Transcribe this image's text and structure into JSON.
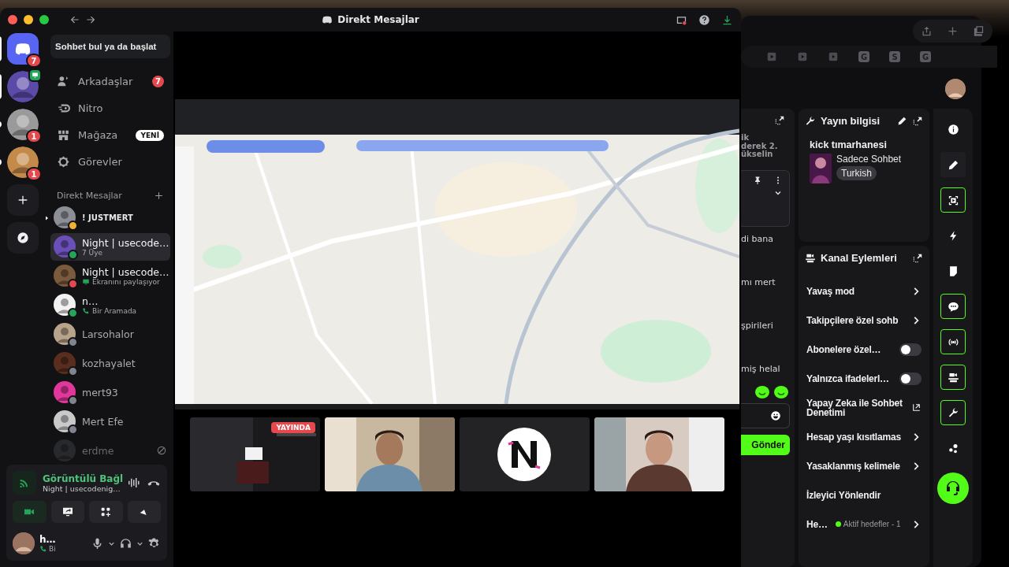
{
  "window": {
    "title": "Direkt Mesajlar"
  },
  "servers": [
    {
      "kind": "home",
      "selected": true,
      "unread": false,
      "badge": "7",
      "sharing": false
    },
    {
      "kind": "avatar",
      "selected": true,
      "unread": false,
      "sharing": true
    },
    {
      "kind": "avatar",
      "selected": false,
      "unread": true,
      "badge": "1",
      "sharing": false
    },
    {
      "kind": "avatar",
      "selected": false,
      "unread": true,
      "badge": "1",
      "sharing": false
    }
  ],
  "search": {
    "placeholder": "Sohbet bul ya da başlat"
  },
  "nav": [
    {
      "kind": "friends",
      "label": "Arkadaşlar",
      "badge": "7"
    },
    {
      "kind": "nitro",
      "label": "Nitro"
    },
    {
      "kind": "shop",
      "label": "Mağaza",
      "tag": "YENİ"
    },
    {
      "kind": "quests",
      "label": "Görevler"
    }
  ],
  "dm_header": {
    "title": "Direkt Mesajlar"
  },
  "dms": [
    {
      "kind": "plain",
      "name": "! JUSTMERT",
      "color": "#f0b232",
      "selected": false,
      "unread": true,
      "blocked": false
    },
    {
      "kind": "plain",
      "name": "Night | usecode…",
      "subtitle": "7 Üye",
      "color": "#23a55a",
      "selected": true,
      "unread": false,
      "blocked": false
    },
    {
      "kind": "screen",
      "name": "Night | usecode…",
      "subtitle": "Ekranını paylaşıyor",
      "color": "#e5484d",
      "selected": false,
      "unread": false,
      "blocked": false
    },
    {
      "kind": "call",
      "name": "n…",
      "subtitle": "Bir Aramada",
      "color": "#23a55a",
      "selected": false,
      "unread": false,
      "blocked": false
    },
    {
      "kind": "plain",
      "name": "Larsohalor",
      "color": "#80848e",
      "selected": false,
      "unread": false,
      "blocked": false
    },
    {
      "kind": "plain",
      "name": "kozhayalet",
      "color": "#80848e",
      "selected": false,
      "unread": false,
      "blocked": false
    },
    {
      "kind": "plain",
      "name": "mert93",
      "color": "#80848e",
      "selected": false,
      "unread": false,
      "blocked": false
    },
    {
      "kind": "plain",
      "name": "Mert Efe",
      "color": "#80848e",
      "selected": false,
      "unread": false,
      "blocked": false
    },
    {
      "kind": "plain",
      "name": "erdme",
      "selected": false,
      "unread": false,
      "blocked": true
    }
  ],
  "voice": {
    "status": "Görüntülü Bağl",
    "channel": "Night | usecodenig…",
    "camera_on": true
  },
  "user": {
    "name": "h…",
    "status": "Bi"
  },
  "stage": {
    "tiles": [
      {
        "kind": "screen",
        "live": "YAYINDA"
      },
      {
        "kind": "camera"
      },
      {
        "kind": "avatar"
      },
      {
        "kind": "camera"
      }
    ]
  },
  "browser_tabs": [
    {
      "kind": "play"
    },
    {
      "kind": "play"
    },
    {
      "kind": "play"
    },
    {
      "kind": "letter",
      "label": "G"
    },
    {
      "kind": "letter",
      "label": "S"
    },
    {
      "kind": "letter",
      "label": "G"
    }
  ],
  "chat": {
    "lines_top": [
      "ik",
      "derek 2.",
      "ükselin"
    ],
    "lines": [
      "di bana",
      "mı mert",
      "şpirileri",
      "miş helal"
    ],
    "send": "Gönder"
  },
  "stream_info": {
    "title": "Yayın bilgisi",
    "stream_title": "kick tımarhanesi",
    "category": "Sadece Sohbet",
    "tag": "Turkish"
  },
  "channel_actions": {
    "title": "Kanal Eylemleri",
    "items": [
      {
        "kind": "link",
        "label": "Yavaş mod"
      },
      {
        "kind": "link",
        "label": "Takipçilere özel sohb"
      },
      {
        "kind": "toggle",
        "label": "Abonelere özel…",
        "on": false
      },
      {
        "kind": "toggle",
        "label": "Yalnızca ifadelerl…",
        "on": false
      },
      {
        "kind": "external",
        "label": "Yapay Zeka ile Sohbet Denetimi"
      },
      {
        "kind": "link",
        "label": "Hesap yaşı kısıtlamas"
      },
      {
        "kind": "link",
        "label": "Yasaklanmış kelimele"
      },
      {
        "kind": "heading",
        "label": "İzleyici Yönlendir"
      },
      {
        "kind": "goal",
        "label": "He…",
        "note": "Aktif hedefler - 1"
      }
    ]
  },
  "tools": [
    {
      "kind": "info",
      "active": false
    },
    {
      "kind": "pencil",
      "active": false
    },
    {
      "kind": "screen",
      "active": true
    },
    {
      "kind": "bolt",
      "active": false
    },
    {
      "kind": "note",
      "active": false
    },
    {
      "kind": "chat",
      "active": true
    },
    {
      "kind": "broadcast",
      "active": true
    },
    {
      "kind": "camera",
      "active": true
    },
    {
      "kind": "wrench",
      "active": true
    },
    {
      "kind": "dots",
      "active": false
    }
  ]
}
